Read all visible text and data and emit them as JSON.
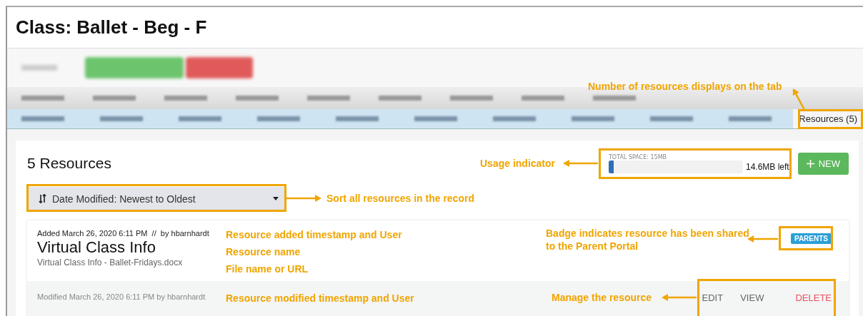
{
  "window": {
    "title": "Class: Ballet - Beg - F"
  },
  "tabs": [
    {
      "label": "Resources (5)",
      "selected": true
    }
  ],
  "resources_panel": {
    "heading": "5 Resources",
    "storage": {
      "caption": "TOTAL SPACE: 15MB",
      "level": 0.04,
      "reading": "14.6MB left"
    },
    "new_button": "NEW",
    "sort": {
      "value": "Date Modified: Newest to Oldest"
    }
  },
  "resources": [
    {
      "added": "Added March 26, 2020 6:11 PM  //  by hbarnhardt",
      "name": "Virtual Class Info",
      "file": "Virtual Class Info - Ballet-Fridays.docx",
      "badge": "PARENTS",
      "modified": "Modified March 26, 2020 6:11 PM by hbarnhardt",
      "actions": [
        {
          "label": "EDIT",
          "kind": "default"
        },
        {
          "label": "VIEW",
          "kind": "default"
        },
        {
          "label": "DELETE",
          "kind": "danger"
        }
      ]
    }
  ],
  "annotations": {
    "tab_count": "Number of resources displays on the tab",
    "usage": "Usage indicator",
    "sort": "Sort all resources in the record",
    "added": "Resource added timestamp and User",
    "name": "Resource name",
    "file": "File name or URL",
    "badge": "Badge indicates resource has been shared to the Parent Portal",
    "modified": "Resource modified timestamp and User",
    "manage": "Manage the resource"
  }
}
